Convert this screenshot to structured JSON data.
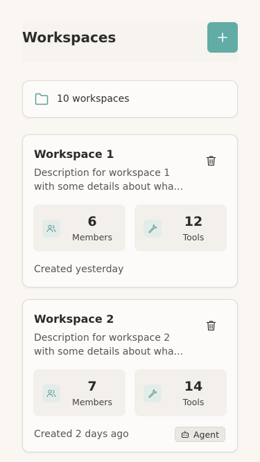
{
  "header": {
    "title": "Workspaces",
    "add_icon": "plus-icon"
  },
  "summary": {
    "count_text": "10 workspaces",
    "icon": "folder-icon"
  },
  "colors": {
    "accent": "#62aca6",
    "icon_tint": "#5e9e98"
  },
  "workspaces": [
    {
      "title": "Workspace 1",
      "description": "Description for workspace 1 with some details about wha...",
      "members_value": "6",
      "members_label": "Members",
      "tools_value": "12",
      "tools_label": "Tools",
      "created": "Created yesterday",
      "badge": ""
    },
    {
      "title": "Workspace 2",
      "description": "Description for workspace 2 with some details about wha...",
      "members_value": "7",
      "members_label": "Members",
      "tools_value": "14",
      "tools_label": "Tools",
      "created": "Created 2 days ago",
      "badge": "Agent"
    }
  ]
}
